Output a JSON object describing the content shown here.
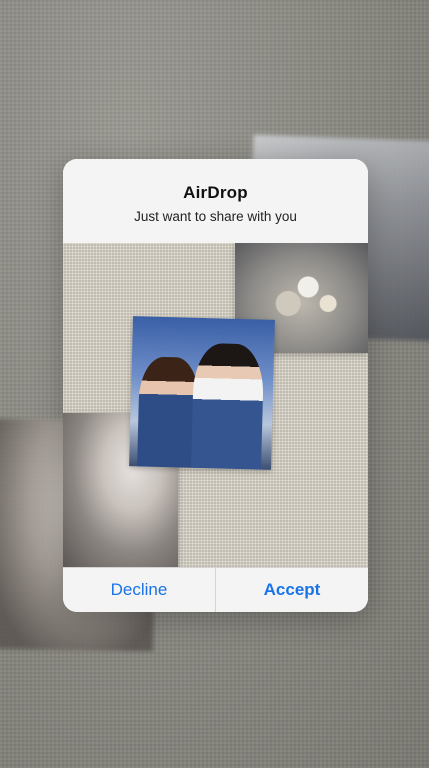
{
  "airdrop_alert": {
    "title": "AirDrop",
    "message": "Just want to share with you",
    "buttons": {
      "decline_label": "Decline",
      "accept_label": "Accept"
    },
    "button_color": "#1a73e8"
  },
  "preview": {
    "photos": [
      "flowers-photo",
      "girls-photo",
      "cat-photo"
    ]
  }
}
